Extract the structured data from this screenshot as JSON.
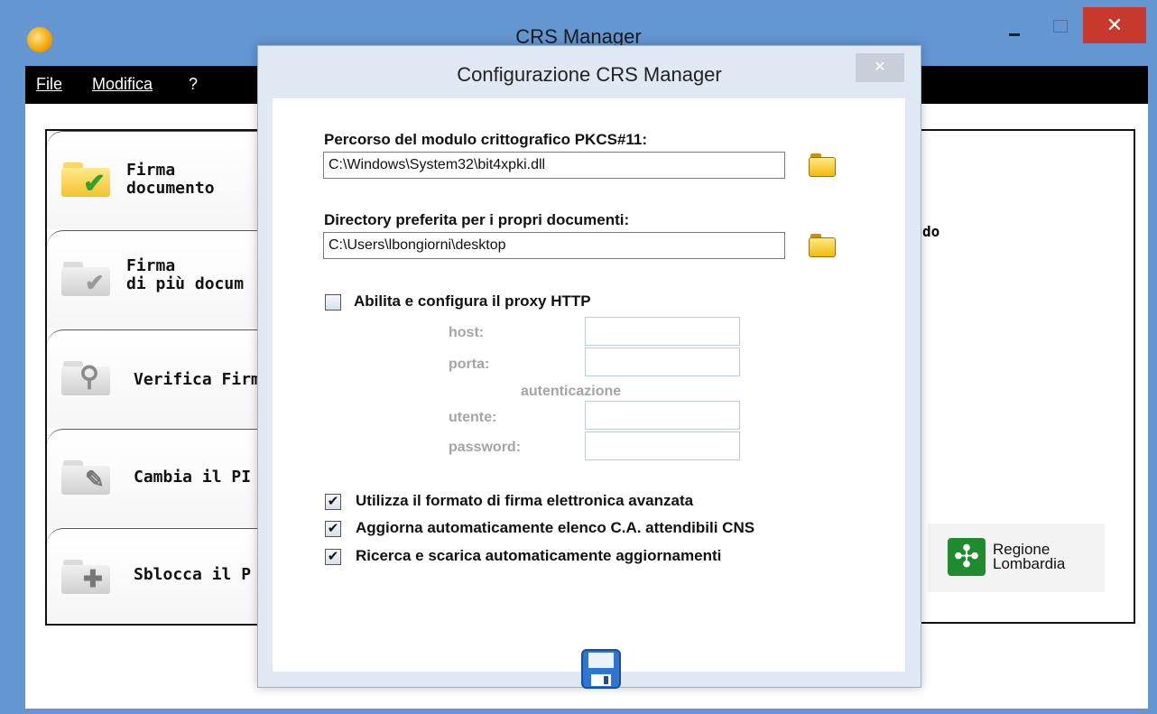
{
  "window": {
    "title": "CRS Manager",
    "close_glyph": "✕"
  },
  "menu": {
    "file": "File",
    "modifica": "Modifica",
    "help": "?"
  },
  "functions": [
    {
      "line1": "Firma",
      "line2": "documento",
      "icon": "folder-check-icon"
    },
    {
      "line1": "Firma",
      "line2": "di più docum",
      "icon": "folder-multi-icon"
    },
    {
      "line1": "Verifica Firm",
      "line2": "",
      "icon": "folder-search-icon"
    },
    {
      "line1": "Cambia il PI",
      "line2": "",
      "icon": "folder-wrench-icon"
    },
    {
      "line1": "Sblocca il P",
      "line2": "",
      "icon": "folder-puzzle-icon"
    }
  ],
  "right_panel": {
    "fragment": "do",
    "logo_line1": "Regione",
    "logo_line2": "Lombardia"
  },
  "dialog": {
    "title": "Configurazione CRS Manager",
    "close_glyph": "✕",
    "pkcs_label": "Percorso del modulo crittografico PKCS#11:",
    "pkcs_value": "C:\\Windows\\System32\\bit4xpki.dll",
    "docs_label": "Directory preferita per i propri documenti:",
    "docs_value": "C:\\Users\\lbongiorni\\desktop",
    "proxy": {
      "enable_label": "Abilita e configura il proxy HTTP",
      "enabled": false,
      "host_label": "host:",
      "porta_label": "porta:",
      "auth_label": "autenticazione",
      "utente_label": "utente:",
      "password_label": "password:",
      "host_value": "",
      "porta_value": "",
      "utente_value": "",
      "password_value": ""
    },
    "options": [
      {
        "label": "Utilizza il formato di firma elettronica avanzata",
        "checked": true,
        "mark": "✔"
      },
      {
        "label": "Aggiorna automaticamente elenco C.A. attendibili CNS",
        "checked": true,
        "mark": "✔"
      },
      {
        "label": "Ricerca e scarica automaticamente aggiornamenti",
        "checked": true,
        "mark": "✔"
      }
    ]
  },
  "colors": {
    "titlebar": "#6496d2",
    "close_button": "#c7392d",
    "menubar": "#000000",
    "dialog_frame": "#dfe8f3"
  }
}
